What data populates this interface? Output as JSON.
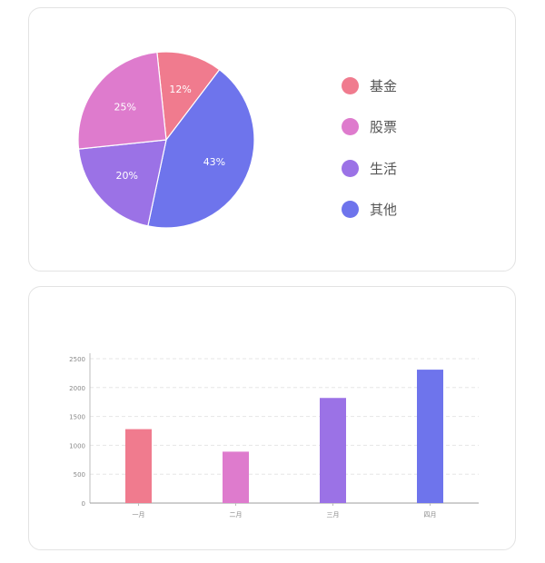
{
  "chart_data": [
    {
      "type": "pie",
      "slices": [
        {
          "label": "基金",
          "value": 12,
          "display": "12%",
          "color": "#f07b8e"
        },
        {
          "label": "股票",
          "value": 25,
          "display": "25%",
          "color": "#de7bcd"
        },
        {
          "label": "生活",
          "value": 20,
          "display": "20%",
          "color": "#9b72e6"
        },
        {
          "label": "其他",
          "value": 43,
          "display": "43%",
          "color": "#6e74ec"
        }
      ],
      "legend_position": "right"
    },
    {
      "type": "bar",
      "categories": [
        "一月",
        "二月",
        "三月",
        "四月"
      ],
      "values": [
        1280,
        890,
        1820,
        2310
      ],
      "colors": [
        "#f07b8e",
        "#de7bcd",
        "#9b72e6",
        "#6e74ec"
      ],
      "ylim": [
        0,
        2500
      ],
      "yticks": [
        "0",
        "500",
        "1000",
        "1500",
        "2000",
        "2500"
      ],
      "grid": true
    }
  ]
}
